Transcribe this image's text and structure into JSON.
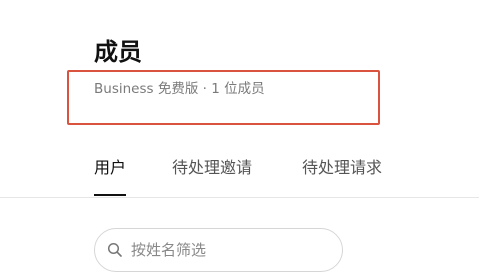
{
  "header": {
    "title": "成员",
    "subtitle": "Business 免费版 · 1 位成员"
  },
  "tabs": [
    {
      "label": "用户",
      "active": true
    },
    {
      "label": "待处理邀请",
      "active": false
    },
    {
      "label": "待处理请求",
      "active": false
    }
  ],
  "search": {
    "placeholder": "按姓名筛选",
    "value": ""
  },
  "colors": {
    "highlight": "#d9533f",
    "active_tab": "#111111",
    "subtitle": "#7a7a7a"
  },
  "icons": {
    "search": "search-icon"
  }
}
